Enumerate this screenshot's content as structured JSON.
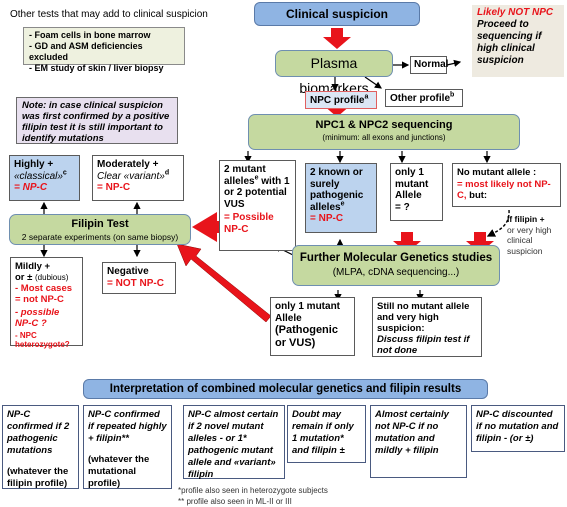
{
  "other_tests": {
    "title": "Other tests that may add to clinical suspicion",
    "items": [
      "- Foam cells in bone marrow",
      "- GD and ASM deficiencies excluded",
      "- EM study of skin / liver biopsy"
    ]
  },
  "clinical_suspicion": "Clinical suspicion",
  "likely_not_npc": {
    "heading": "Likely NOT NPC",
    "text": "Proceed to sequencing if high clinical suspicion"
  },
  "plasma_biomarkers": "Plasma biomarkers",
  "normal": "Normal",
  "npc_profile": {
    "label": "NPC profile",
    "sup": "a"
  },
  "other_profile": {
    "label": "Other profile",
    "sup": "b"
  },
  "note": "Note: in case clinical suspicion was first confirmed by a positive filipin test it is still important to identify mutations",
  "sequencing": {
    "title": "NPC1 & NPC2 sequencing",
    "subtitle": "(minimum: all exons and junctions)"
  },
  "highly": {
    "line1": "Highly +",
    "line2": "«classical»",
    "sup": "c",
    "result": "=  NP-C"
  },
  "moderately": {
    "line1": "Moderately +",
    "line2": "Clear «variant»",
    "sup": "d",
    "result": "=  NP-C"
  },
  "filipin": {
    "title": "Filipin Test",
    "subtitle": "2 separate experiments (on same biopsy)"
  },
  "mildly": {
    "line1": "Mildly +",
    "line2a": "or ± ",
    "line2b": "(dubious)",
    "r1": "- Most cases = not NP-C",
    "r2": "- possible NP-C ?",
    "r3": "- NPC heterozygote?"
  },
  "negative": {
    "label": "Negative",
    "result": "= NOT NP-C"
  },
  "two_mutant_vus": {
    "pre": "2 mutant alleles",
    "sup": "e",
    "post": " with 1 or 2 potential VUS",
    "result": "= Possible NP-C"
  },
  "two_known": {
    "text": "2 known or surely pathogenic alleles",
    "sup": "e",
    "result": "= NP-C"
  },
  "only_one": {
    "text": "only 1 mutant Allele",
    "result": "= ?"
  },
  "no_mutant": {
    "label": "No mutant allele :",
    "result": "= most likely not NP-C,",
    "tail": " but:"
  },
  "if_filipin": {
    "bold": "If filipin +",
    "rest": "or very high clinical suspicion"
  },
  "further": {
    "title": "Further Molecular Genetics studies",
    "subtitle": "(MLPA, cDNA sequencing...)"
  },
  "only_one_path": {
    "line1": "only 1 mutant Allele",
    "line2": "(Pathogenic or VUS)"
  },
  "still_no": {
    "text": "Still no mutant allele and very high suspicion:",
    "italic": "Discuss filipin test if not done"
  },
  "interpretation": {
    "title": "Interpretation of combined molecular genetics and filipin results",
    "boxes": [
      {
        "italic": "NP-C confirmed if 2 pathogenic mutations",
        "normal": "(whatever the filipin profile)"
      },
      {
        "italic": "NP-C confirmed if repeated highly + filipin**",
        "normal": "(whatever the mutational profile)"
      },
      {
        "italic": "NP-C  almost certain if  2 novel mutant alleles - or  1* pathogenic mutant allele and «variant» filipin",
        "normal": ""
      },
      {
        "italic": "Doubt may remain if only 1 mutation* and filipin ±",
        "normal": ""
      },
      {
        "italic": "Almost certainly not NP-C if no mutation and mildly + filipin",
        "normal": ""
      },
      {
        "italic": "NP-C discounted if no mutation and filipin - (or ±)",
        "normal": ""
      }
    ],
    "footnotes": [
      "*profile also seen in heterozygote subjects",
      "** profile also seen in ML-II or III"
    ]
  },
  "colors": {
    "red_arrow": "#e8141b",
    "green_box": "#c5d9a0",
    "blue_box": "#bcd3ee",
    "header_blue": "#8fb4e3"
  }
}
